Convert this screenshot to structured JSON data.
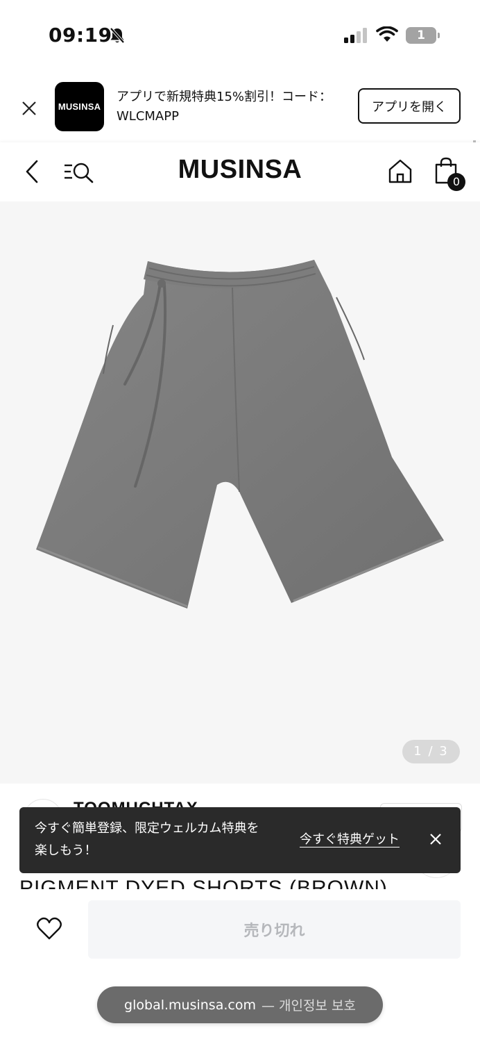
{
  "status_bar": {
    "time": "09:19",
    "battery": "1",
    "icons": [
      "bell-slash-icon",
      "signal-icon",
      "wifi-icon",
      "battery-icon"
    ]
  },
  "app_banner": {
    "logo_text": "MUSINSA",
    "line1": "アプリで新規特典15%割引！コード：",
    "line2": "WLCMAPP",
    "open_button": "アプリを開く"
  },
  "header": {
    "logo": "MUSINSA",
    "cart_count": "0"
  },
  "product": {
    "image_counter": "1 / 3",
    "image_color": "#7a7a7a",
    "brand_name": "TOOMUCHTAX",
    "title": "PIGMENT DYED SHORTS (BROWN)"
  },
  "toast": {
    "line1": "今すぐ簡単登録、限定ウェルカム特典を",
    "line2": "楽しもう！",
    "link": "今すぐ特典ゲット"
  },
  "purchase": {
    "sold_out_label": "売り切れ"
  },
  "browser": {
    "domain": "global.musinsa.com",
    "suffix": "— 개인정보 보호"
  }
}
